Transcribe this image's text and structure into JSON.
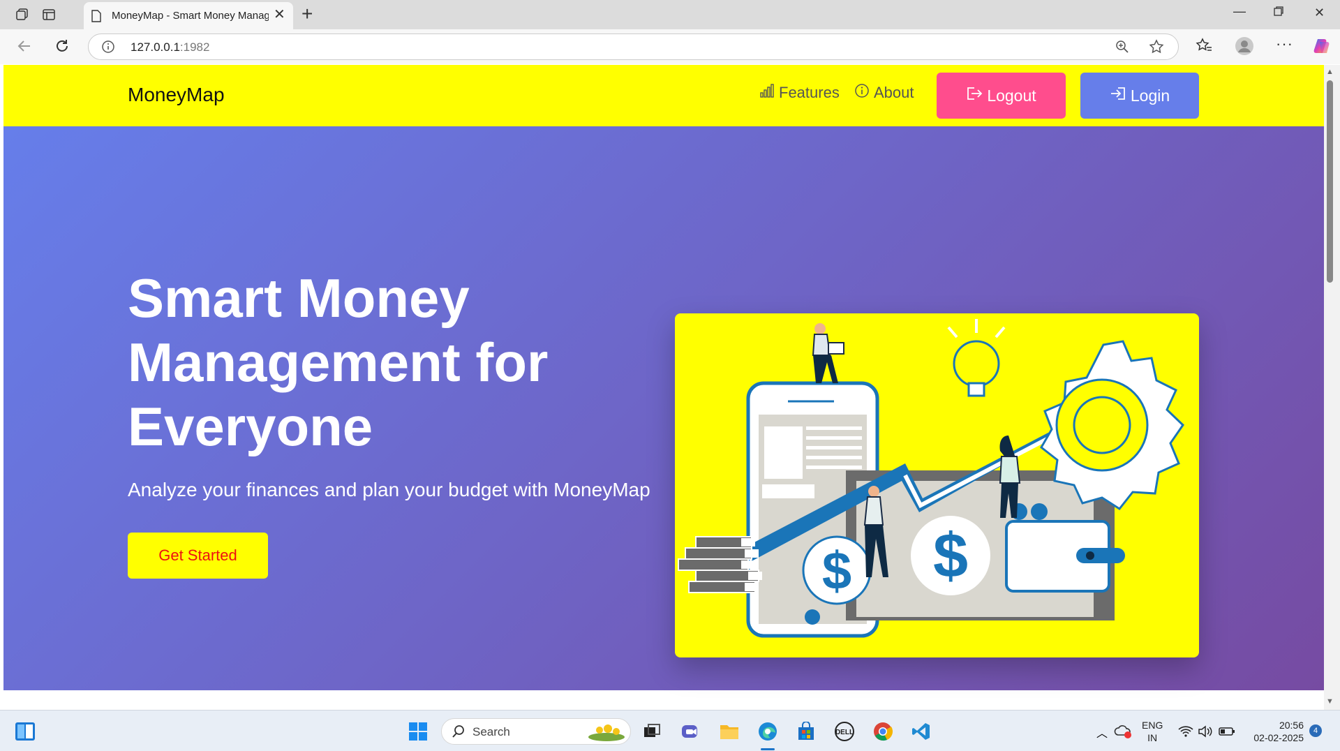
{
  "browser": {
    "tab_title": "MoneyMap - Smart Money Management",
    "url_host": "127.0.0.1",
    "url_port": ":1982"
  },
  "navbar": {
    "brand": "MoneyMap",
    "features": "Features",
    "about": "About",
    "logout": "Logout",
    "login": "Login"
  },
  "hero": {
    "title": "Smart Money Management for Everyone",
    "subtitle": "Analyze your finances and plan your budget with MoneyMap",
    "cta": "Get Started"
  },
  "colors": {
    "navbar_bg": "#ffff00",
    "logout_bg": "#ff4d8d",
    "login_bg": "#667eea",
    "hero_gradient_start": "#667eea",
    "hero_gradient_end": "#764ba2",
    "cta_text": "#ee1111"
  },
  "taskbar": {
    "search_label": "Search",
    "lang_1": "ENG",
    "lang_2": "IN",
    "time": "20:56",
    "date": "02-02-2025",
    "notifications": "4"
  },
  "icons": [
    "browser-workspaces-icon",
    "tab-actions-icon",
    "page-icon",
    "close-icon",
    "plus-icon",
    "minimize-icon",
    "restore-icon",
    "back-icon",
    "refresh-icon",
    "info-icon",
    "zoom-icon",
    "favorite-star-icon",
    "favorites-icon",
    "profile-icon",
    "more-icon",
    "copilot-icon",
    "chart-bar-icon",
    "info-circle-icon",
    "logout-icon",
    "login-icon",
    "windows-start-icon",
    "search-icon",
    "wifi-icon",
    "volume-icon",
    "battery-icon"
  ]
}
